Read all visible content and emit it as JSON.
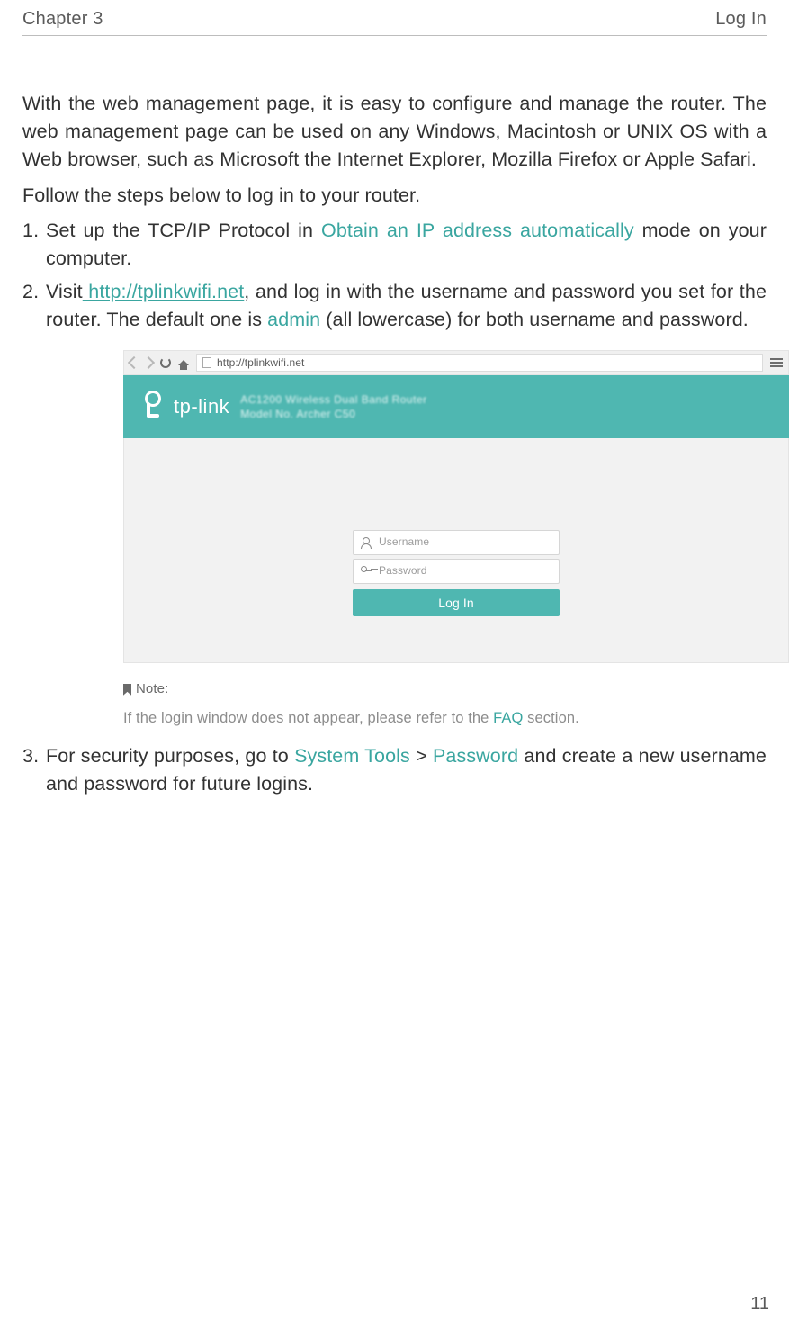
{
  "header": {
    "chapter": "Chapter 3",
    "title": "Log In"
  },
  "intro": "With the web management page, it is easy to configure and manage the router. The web management page can be used on any Windows, Macintosh or UNIX OS with a Web browser, such as Microsoft the Internet Explorer, Mozilla Firefox or Apple Safari.",
  "follow": "Follow the steps below to log in to your router.",
  "step1": {
    "pre": "Set up the TCP/IP Protocol in ",
    "teal": "Obtain an IP address automatically",
    "post": " mode on your computer."
  },
  "step2": {
    "pre": "Visit",
    "link": " http://tplinkwifi.net",
    "mid": ", and log in with the username and password you set for the router. The default one is ",
    "teal": "admin",
    "post": " (all lowercase) for both username and password."
  },
  "browser": {
    "url": "http://tplinkwifi.net"
  },
  "router": {
    "brand": "tp-link",
    "title_line1": "AC1200 Wireless Dual Band Router",
    "title_line2": "Model No. Archer C50"
  },
  "login": {
    "username_ph": "Username",
    "password_ph": "Password",
    "button": "Log In"
  },
  "note": {
    "label": "Note:",
    "pre": "If the login window does not appear, please refer to the ",
    "link": "FAQ",
    "post": " section."
  },
  "step3": {
    "pre": "For security purposes, go to ",
    "teal1": "System Tools",
    "gt": " > ",
    "teal2": "Password",
    "post": " and create a new username and password for future logins."
  },
  "page_number": "11"
}
